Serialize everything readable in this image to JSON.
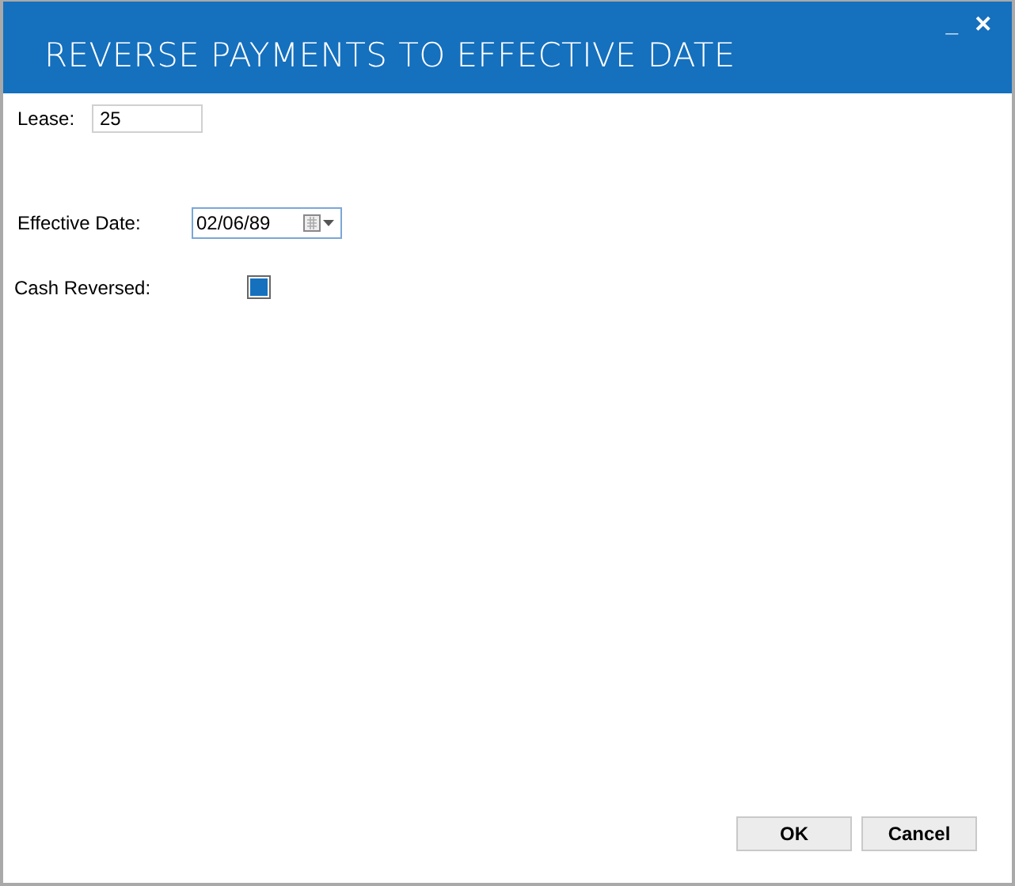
{
  "window": {
    "title": "REVERSE PAYMENTS TO EFFECTIVE DATE",
    "minimize_glyph": "_",
    "close_glyph": "✕"
  },
  "lease": {
    "label": "Lease:",
    "value": "25"
  },
  "effective_date": {
    "label": "Effective Date:",
    "value": "02/06/89"
  },
  "cash_reversed": {
    "label": "Cash Reversed:",
    "checked": true
  },
  "buttons": [
    {
      "label": "OK"
    },
    {
      "label": "Cancel"
    }
  ]
}
